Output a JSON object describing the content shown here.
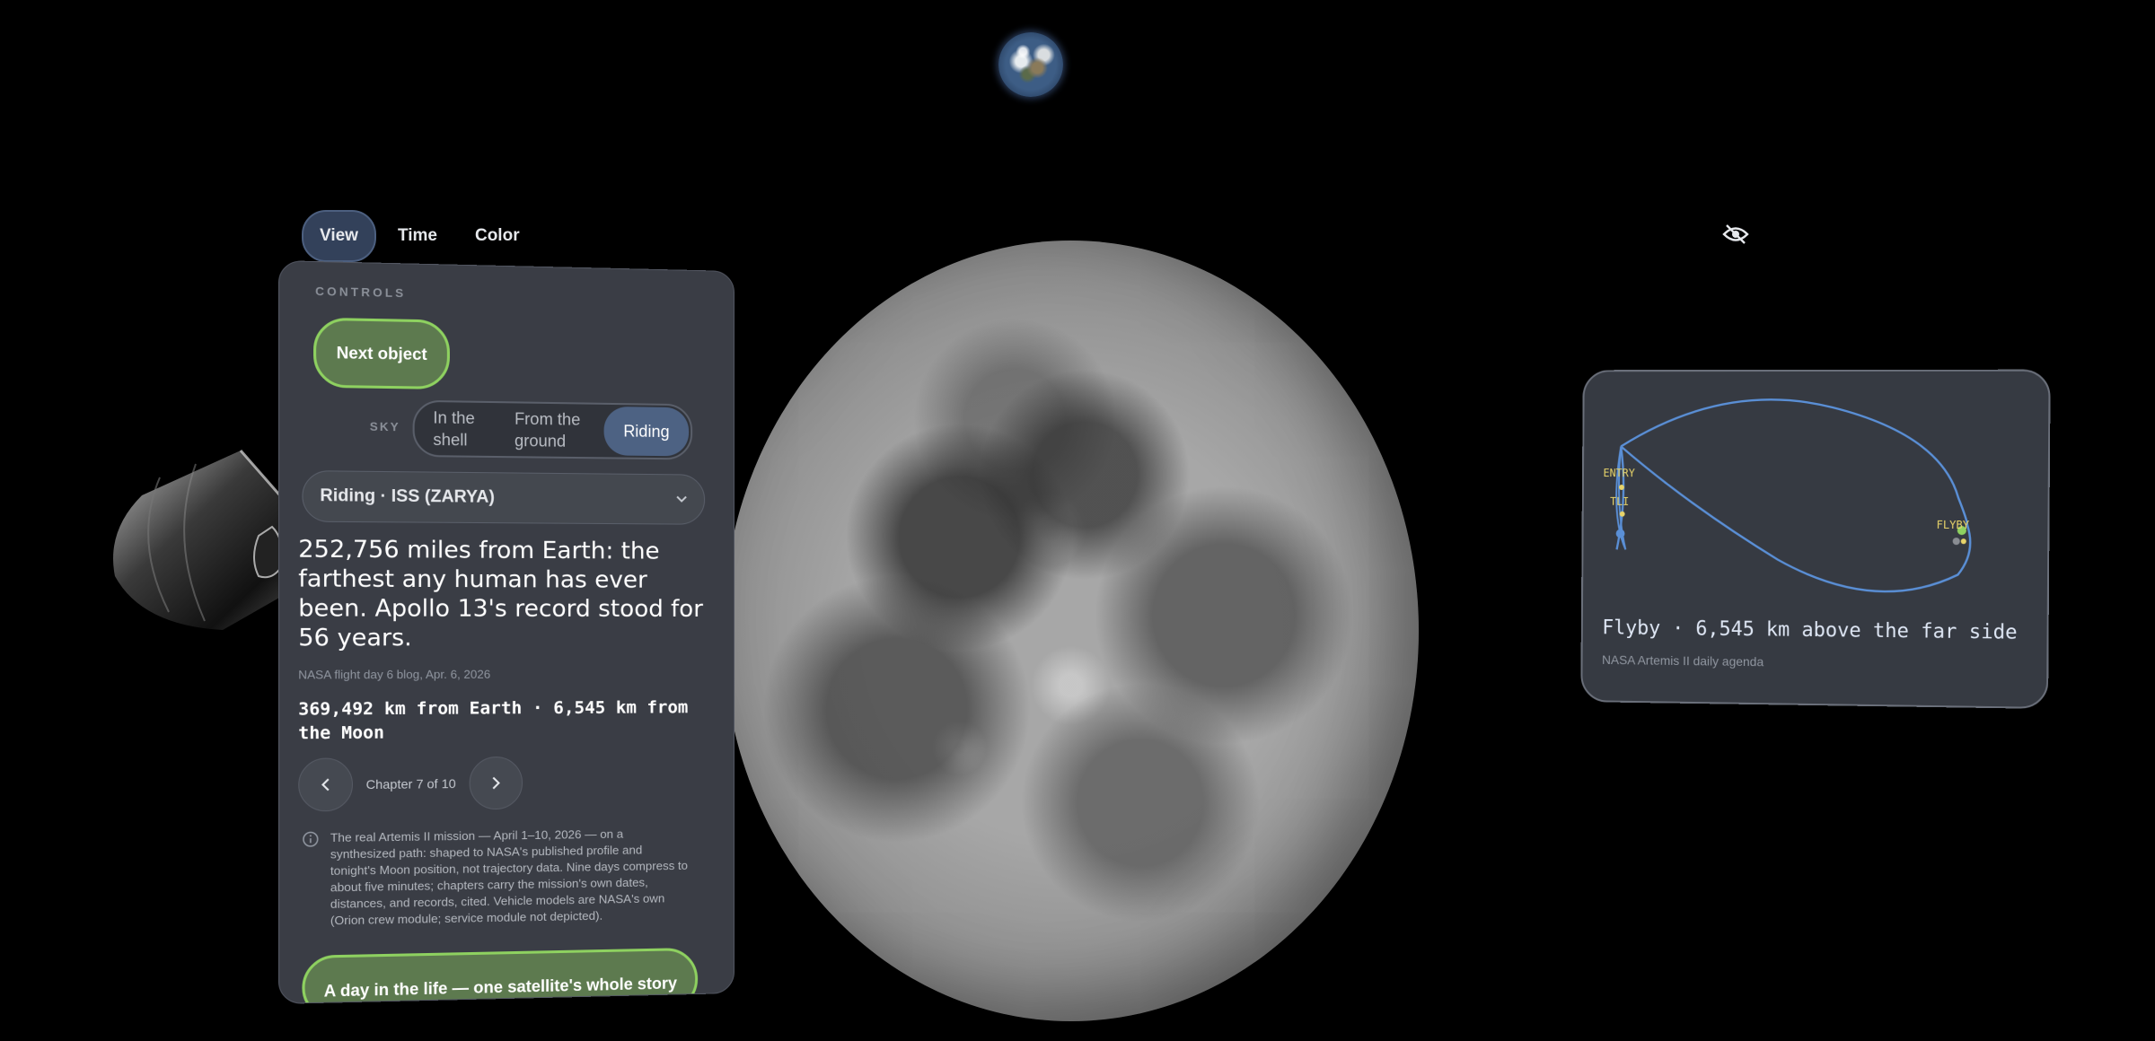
{
  "tabs": [
    {
      "label": "View",
      "active": true
    },
    {
      "label": "Time",
      "active": false
    },
    {
      "label": "Color",
      "active": false
    }
  ],
  "visibility_icon": "eye-slash-icon",
  "controls": {
    "section_label": "CONTROLS",
    "next_button": "Next object",
    "sky_label": "SKY",
    "sky_options": [
      "In the shell",
      "From the ground",
      "Riding"
    ],
    "sky_selected": "Riding",
    "dropdown_value": "Riding · ISS (ZARYA)",
    "headline": "252,756 miles from Earth: the farthest any human has ever been. Apollo 13's record stood for 56 years.",
    "headline_source": "NASA flight day 6 blog, Apr. 6, 2026",
    "distance": "369,492 km from Earth · 6,545 km from the Moon",
    "chapter": "Chapter 7 of 10",
    "disclaimer": "The real Artemis II mission — April 1–10, 2026 — on a synthesized path: shaped to NASA's published profile and tonight's Moon position, not trajectory data. Nine days compress to about five minutes; chapters carry the mission's own dates, distances, and records, cited. Vehicle models are NASA's own (Orion crew module; service module not depicted).",
    "story_button": "A day in the life — one satellite's whole story"
  },
  "trajectory": {
    "labels": {
      "entry": "ENTRY",
      "tli": "TLI",
      "flyby": "FLYBY"
    },
    "caption": "Flyby · 6,545 km above the far side",
    "source": "NASA Artemis II daily agenda"
  },
  "colors": {
    "accent_green": "#8ed160",
    "accent_blue": "#4d6283",
    "path_blue": "#5a8fd6"
  }
}
